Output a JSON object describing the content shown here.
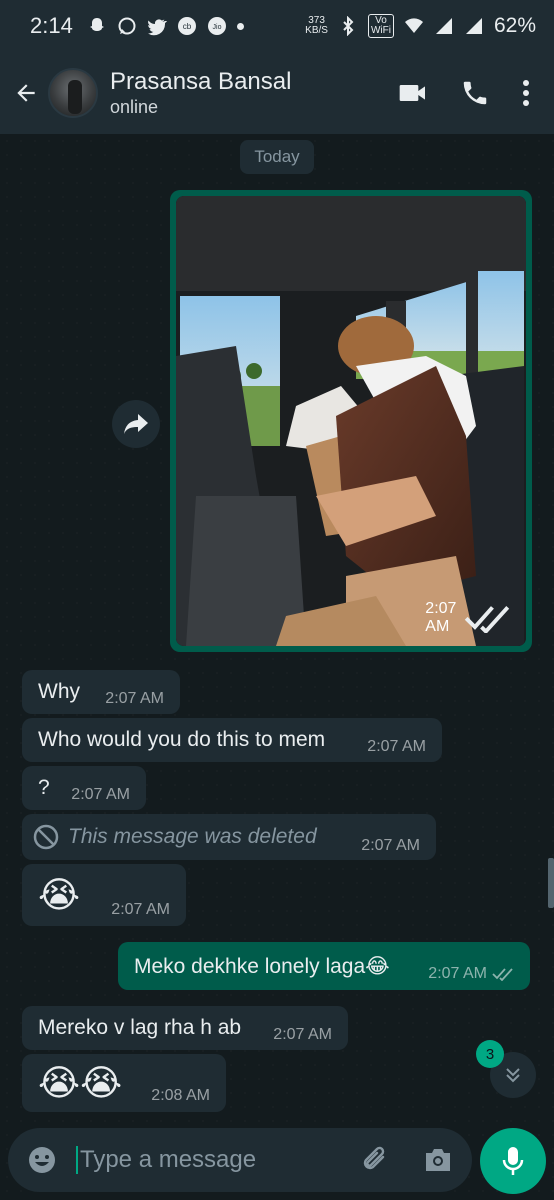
{
  "status_bar": {
    "time": "2:14",
    "net_speed_value": "373",
    "net_speed_unit": "KB/S",
    "wifi_badge_top": "Vo",
    "wifi_badge_bottom": "WiFi",
    "battery": "62%"
  },
  "header": {
    "contact_name": "Prasansa Bansal",
    "contact_status": "online"
  },
  "chat": {
    "date_chip": "Today",
    "image_time": "2:07 AM",
    "messages": [
      {
        "text": "Why",
        "time": "2:07 AM"
      },
      {
        "text": "Who would you do this to mem",
        "time": "2:07 AM"
      },
      {
        "text": "?",
        "time": "2:07 AM"
      },
      {
        "text": "This message was deleted",
        "time": "2:07 AM"
      },
      {
        "text": "😭",
        "time": "2:07 AM"
      },
      {
        "text": "Meko dekhke lonely laga😂",
        "time": "2:07 AM"
      },
      {
        "text": "Mereko v lag rha h ab",
        "time": "2:07 AM"
      },
      {
        "text": "😭😭",
        "time": "2:08 AM"
      }
    ],
    "unread_count": "3"
  },
  "composer": {
    "placeholder": "Type a message"
  },
  "colors": {
    "accent": "#00a884",
    "outgoing_bubble": "#005c4b",
    "incoming_bubble": "#1f2c33",
    "background": "#131b1e"
  },
  "icons": [
    "snapchat-icon",
    "whatsapp-icon",
    "twitter-icon",
    "bluetooth-icon",
    "wifi-icon",
    "signal-icon",
    "video-call-icon",
    "voice-call-icon",
    "more-icon",
    "forward-icon",
    "double-check-icon",
    "deleted-icon",
    "emoji-icon",
    "attach-icon",
    "camera-icon",
    "mic-icon",
    "chevron-double-down-icon"
  ]
}
